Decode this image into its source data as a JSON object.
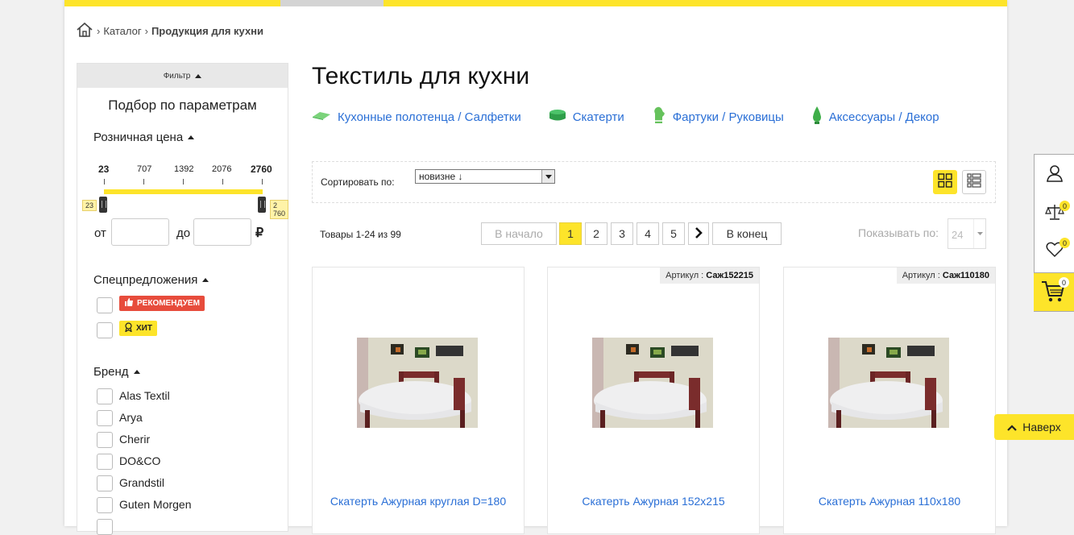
{
  "breadcrumb": {
    "catalog": "Каталог",
    "current": "Продукция для кухни"
  },
  "filter": {
    "toggle_label": "Фильтр",
    "title": "Подбор по параметрам",
    "price_label": "Розничная цена",
    "scale": [
      "23",
      "707",
      "1392",
      "2076",
      "2760"
    ],
    "min_handle": "23",
    "max_handle": "2 760",
    "from_label": "от",
    "to_label": "до",
    "currency": "₽",
    "offers_label": "Спецпредложения",
    "badge_rec": "РЕКОМЕНДУЕМ",
    "badge_hit": "ХИТ",
    "brand_label": "Бренд",
    "brands": [
      "Alas Textil",
      "Arya",
      "Cherir",
      "DO&CO",
      "Grandstil",
      "Guten Morgen"
    ]
  },
  "main": {
    "title": "Текстиль для кухни",
    "categories": [
      "Кухонные полотенца / Салфетки",
      "Скатерти",
      "Фартуки / Руковицы",
      "Аксессуары / Декор"
    ],
    "sort_label": "Сортировать по:",
    "sort_value": "новизне ↓",
    "count_text": "Товары 1-24 из 99",
    "pager": {
      "first": "В начало",
      "pages": [
        "1",
        "2",
        "3",
        "4",
        "5"
      ],
      "last": "В конец"
    },
    "show_label": "Показывать по:",
    "show_value": "24"
  },
  "products": [
    {
      "article_label": "",
      "article": "",
      "name": "Скатерть Ажурная круглая D=180"
    },
    {
      "article_label": "Артикул :",
      "article": "Саж152215",
      "name": "Скатерть Ажурная 152х215"
    },
    {
      "article_label": "Артикул :",
      "article": "Саж110180",
      "name": "Скатерть Ажурная 110х180"
    }
  ],
  "widgets": {
    "compare_count": "0",
    "fav_count": "0",
    "cart_count": "0",
    "up_label": "Наверх"
  },
  "colors": {
    "accent": "#fde42a",
    "link": "#2a6fd6",
    "red": "#e74c3c"
  }
}
